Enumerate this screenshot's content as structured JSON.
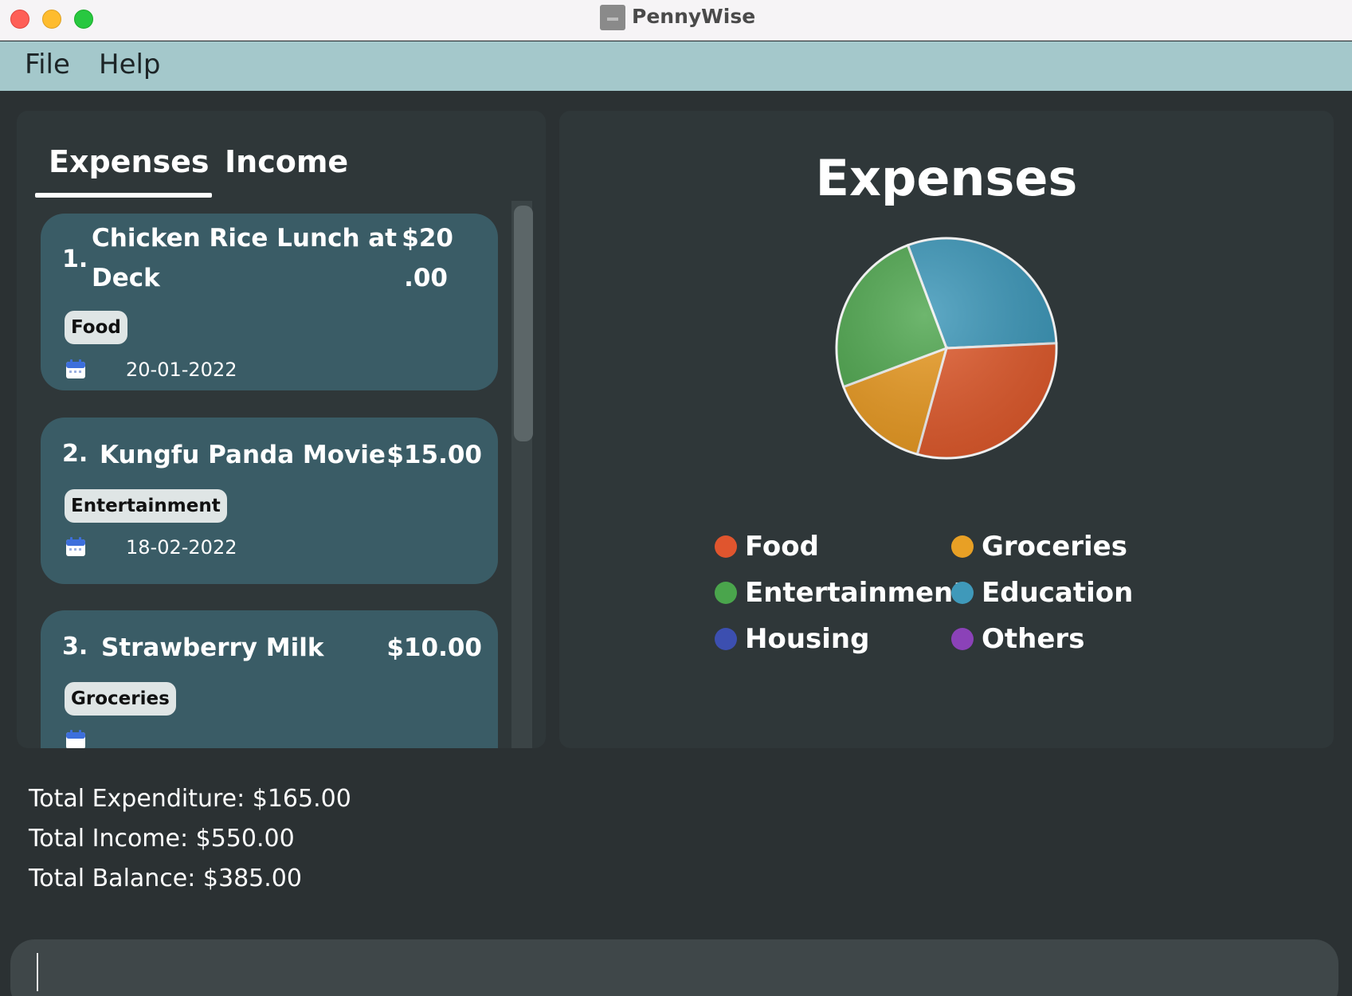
{
  "window": {
    "title": "PennyWise"
  },
  "menu": {
    "file": "File",
    "help": "Help"
  },
  "tabs": {
    "expenses": "Expenses",
    "income": "Income"
  },
  "expenses": [
    {
      "index": "1.",
      "title_line1": "Chicken Rice Lunch at",
      "title_line2": "Deck",
      "amount_line1": "$20",
      "amount_line2": ".00",
      "category": "Food",
      "date": "20-01-2022"
    },
    {
      "index": "2.",
      "title": "Kungfu Panda Movie",
      "amount": "$15.00",
      "category": "Entertainment",
      "date": "18-02-2022"
    },
    {
      "index": "3.",
      "title": "Strawberry Milk",
      "amount": "$10.00",
      "category": "Groceries"
    }
  ],
  "chart_data": {
    "type": "pie",
    "title": "Expenses",
    "slices": [
      {
        "label": "Education",
        "value": 30,
        "color": "#3c97b9"
      },
      {
        "label": "Food",
        "value": 30,
        "color": "#e05a2c"
      },
      {
        "label": "Groceries",
        "value": 15,
        "color": "#e99a22"
      },
      {
        "label": "Entertainment",
        "value": 25,
        "color": "#4ea64e"
      }
    ],
    "legend": [
      {
        "label": "Food",
        "color": "#e0552e"
      },
      {
        "label": "Groceries",
        "color": "#e8a025"
      },
      {
        "label": "Entertainment",
        "color": "#4aa54c"
      },
      {
        "label": "Education",
        "color": "#3f99ba"
      },
      {
        "label": "Housing",
        "color": "#3c4fb0"
      },
      {
        "label": "Others",
        "color": "#8b42b8"
      }
    ]
  },
  "totals": {
    "expenditure": "Total Expenditure: $165.00",
    "income": "Total Income: $550.00",
    "balance": "Total Balance: $385.00"
  },
  "command": {
    "value": ""
  }
}
